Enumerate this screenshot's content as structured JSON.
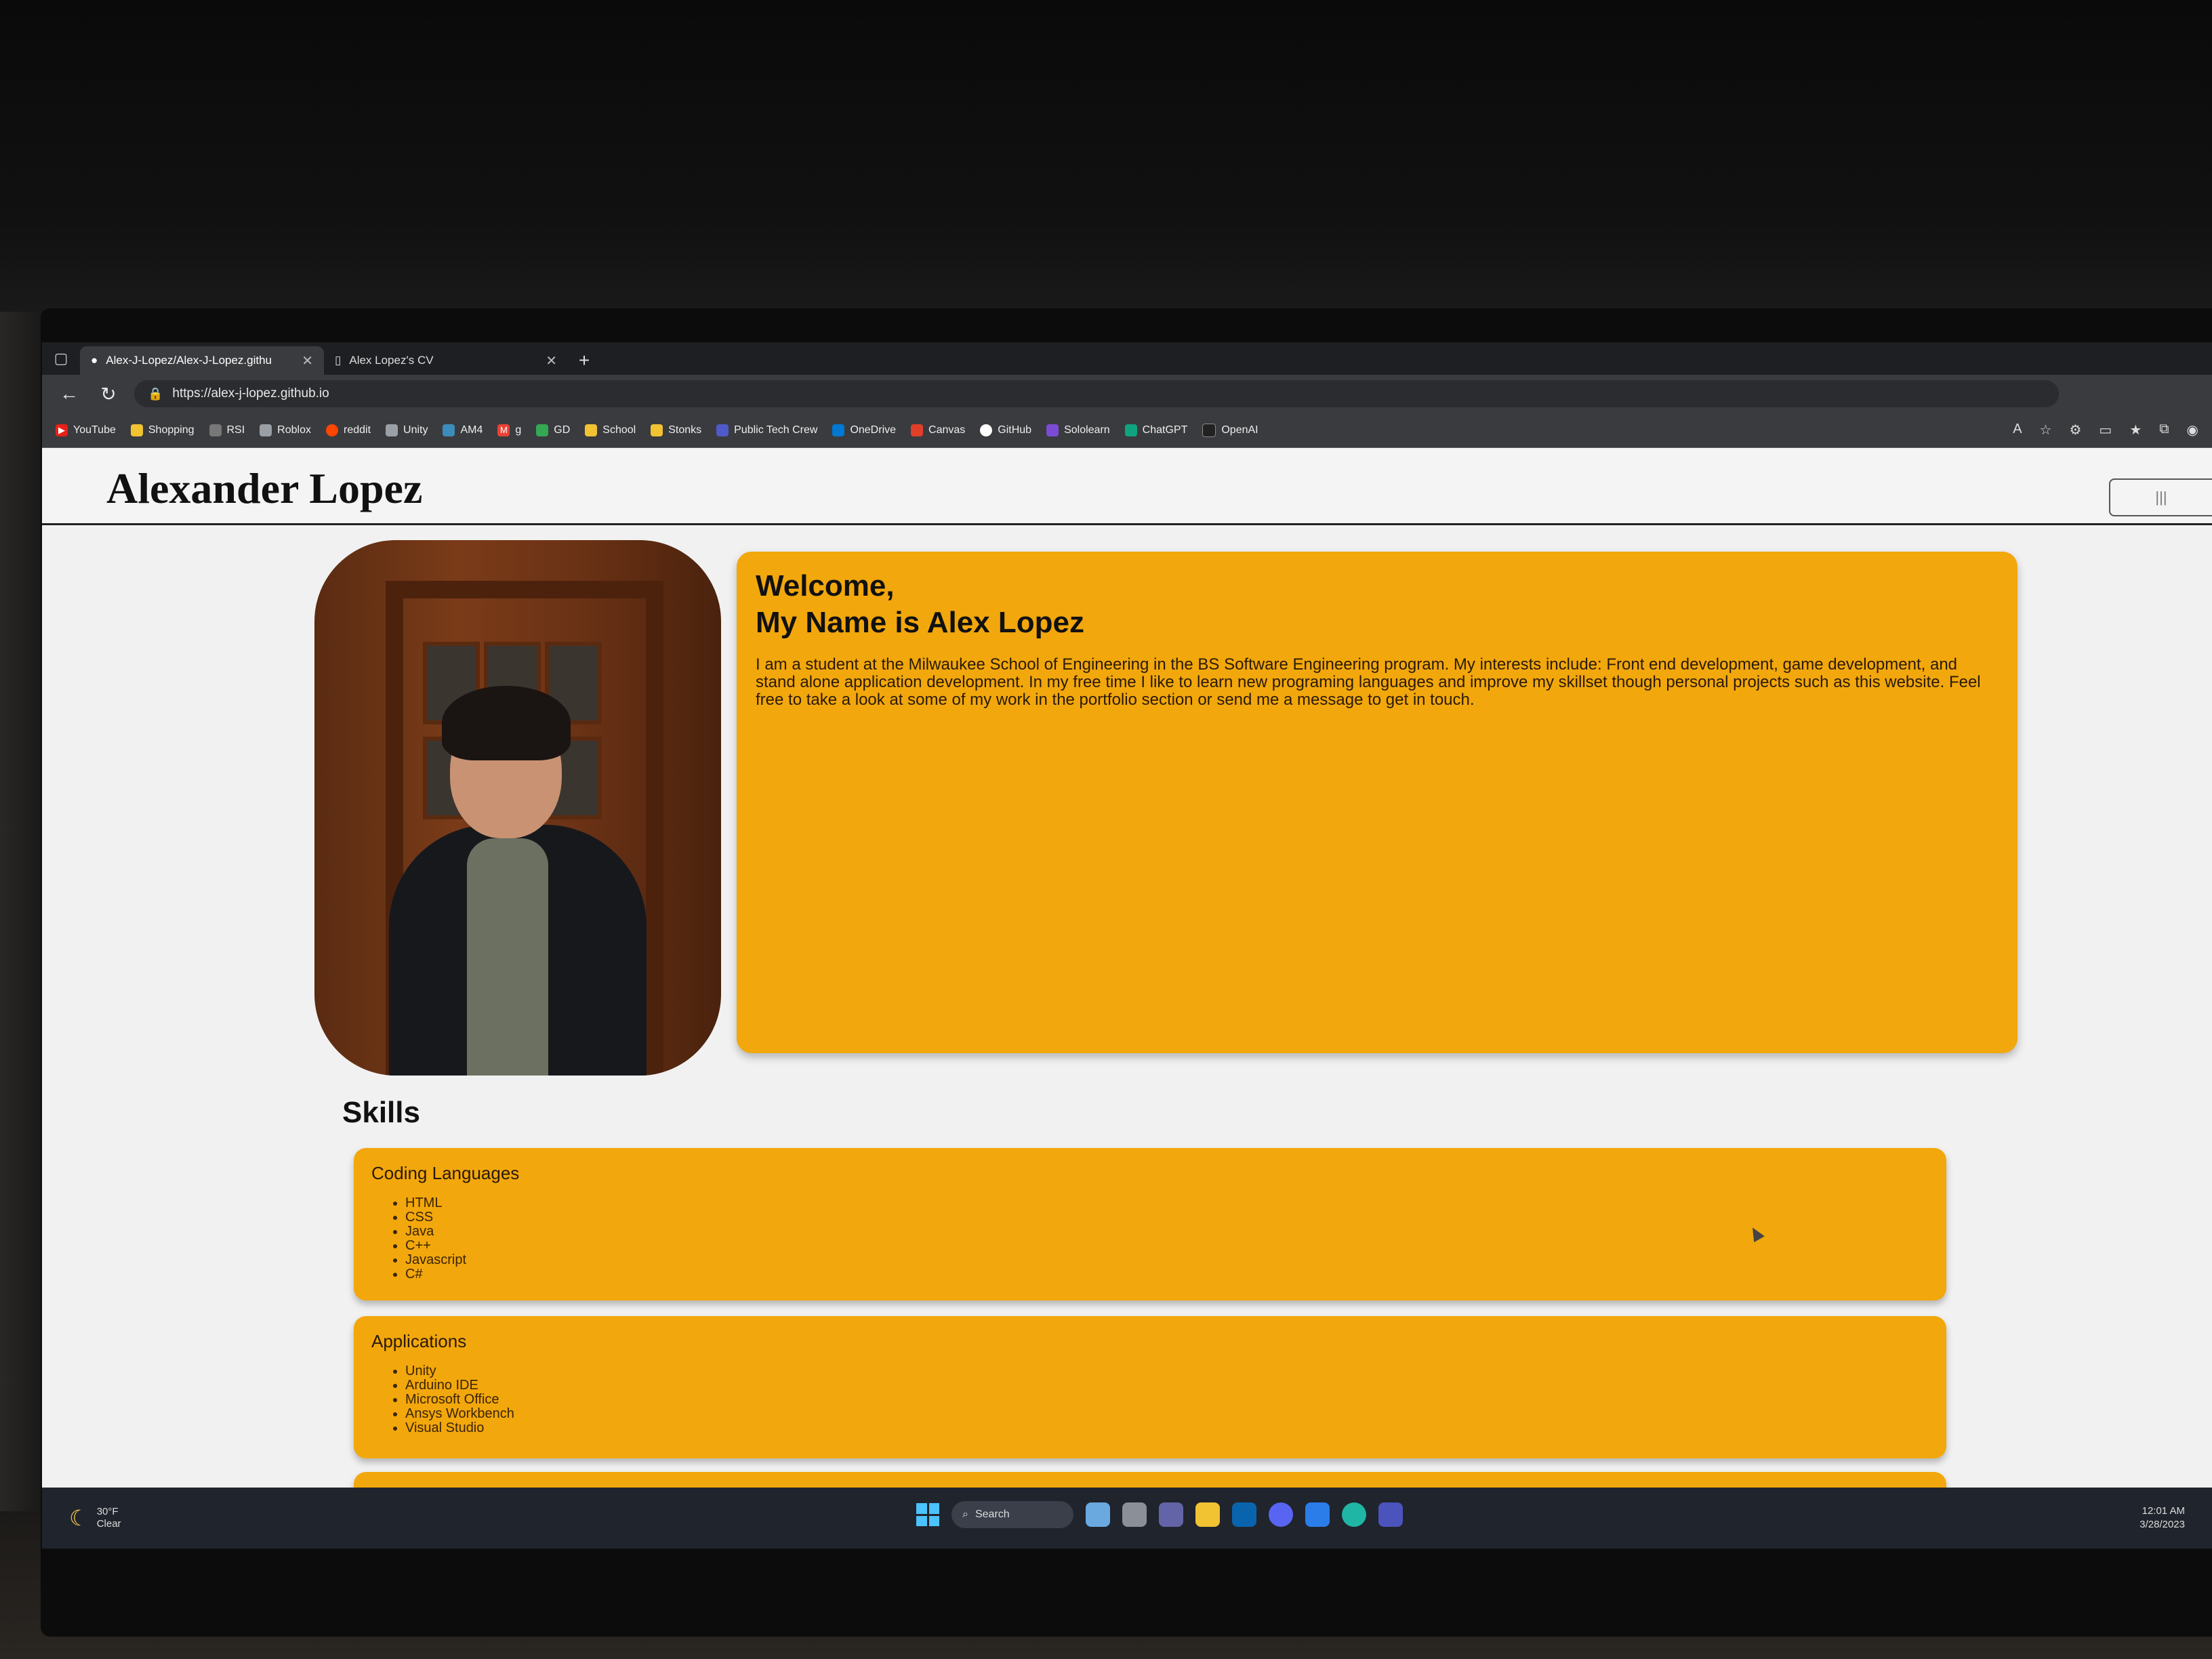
{
  "browser": {
    "tabs": [
      {
        "title": "Alex-J-Lopez/Alex-J-Lopez.githu",
        "icon": "github-icon",
        "active": true
      },
      {
        "title": "Alex Lopez's CV",
        "icon": "page-icon",
        "active": false
      }
    ],
    "new_tab_label": "+",
    "url": "https://alex-j-lopez.github.io",
    "bookmarks": [
      {
        "label": "YouTube",
        "icon": "youtube-icon",
        "color": "#e62117"
      },
      {
        "label": "Shopping",
        "icon": "folder-icon",
        "color": "#f1c232"
      },
      {
        "label": "RSI",
        "icon": "rsi-icon",
        "color": "#777777"
      },
      {
        "label": "Roblox",
        "icon": "roblox-icon",
        "color": "#9aa0a6"
      },
      {
        "label": "reddit",
        "icon": "reddit-icon",
        "color": "#ff4500"
      },
      {
        "label": "Unity",
        "icon": "unity-icon",
        "color": "#9aa0a6"
      },
      {
        "label": "AM4",
        "icon": "am4-icon",
        "color": "#3c8dbc"
      },
      {
        "label": "g",
        "icon": "gmail-icon",
        "color": "#ea4335"
      },
      {
        "label": "GD",
        "icon": "google-drive-icon",
        "color": "#34a853"
      },
      {
        "label": "School",
        "icon": "folder-icon",
        "color": "#f1c232"
      },
      {
        "label": "Stonks",
        "icon": "folder-icon",
        "color": "#f1c232"
      },
      {
        "label": "Public Tech Crew",
        "icon": "teams-icon",
        "color": "#5059c9"
      },
      {
        "label": "OneDrive",
        "icon": "onedrive-icon",
        "color": "#0078d4"
      },
      {
        "label": "Canvas",
        "icon": "canvas-icon",
        "color": "#e13f29"
      },
      {
        "label": "GitHub",
        "icon": "github-icon",
        "color": "#ffffff"
      },
      {
        "label": "Sololearn",
        "icon": "sololearn-icon",
        "color": "#7b4bd6"
      },
      {
        "label": "ChatGPT",
        "icon": "chatgpt-icon",
        "color": "#10a37f"
      },
      {
        "label": "OpenAI",
        "icon": "openai-icon",
        "color": "#222222"
      }
    ]
  },
  "site": {
    "title": "Alexander Lopez",
    "menu_label": "|||",
    "welcome": {
      "line1": "Welcome,",
      "line2": "My Name is Alex Lopez",
      "body": "I am a student at the Milwaukee School of Engineering in the BS Software Engineering program. My interests include: Front end development, game development, and stand alone application development. In my free time I like to learn new programing languages and improve my skillset though personal projects such as this website. Feel free to take a look at some of my work in the portfolio section or send me a message to get in touch."
    },
    "skills_heading": "Skills",
    "skill_groups": [
      {
        "title": "Coding Languages",
        "items": [
          "HTML",
          "CSS",
          "Java",
          "C++",
          "Javascript",
          "C#"
        ]
      },
      {
        "title": "Applications",
        "items": [
          "Unity",
          "Arduino IDE",
          "Microsoft Office",
          "Ansys Workbench",
          "Visual Studio"
        ]
      }
    ]
  },
  "taskbar": {
    "weather_temp": "30°F",
    "weather_text": "Clear",
    "search_label": "Search",
    "time": "12:01 AM",
    "date": "3/28/2023"
  },
  "colors": {
    "accent": "#f2a70c",
    "page_bg": "#f1f1f1",
    "chrome_bg": "#3a3b3e"
  }
}
